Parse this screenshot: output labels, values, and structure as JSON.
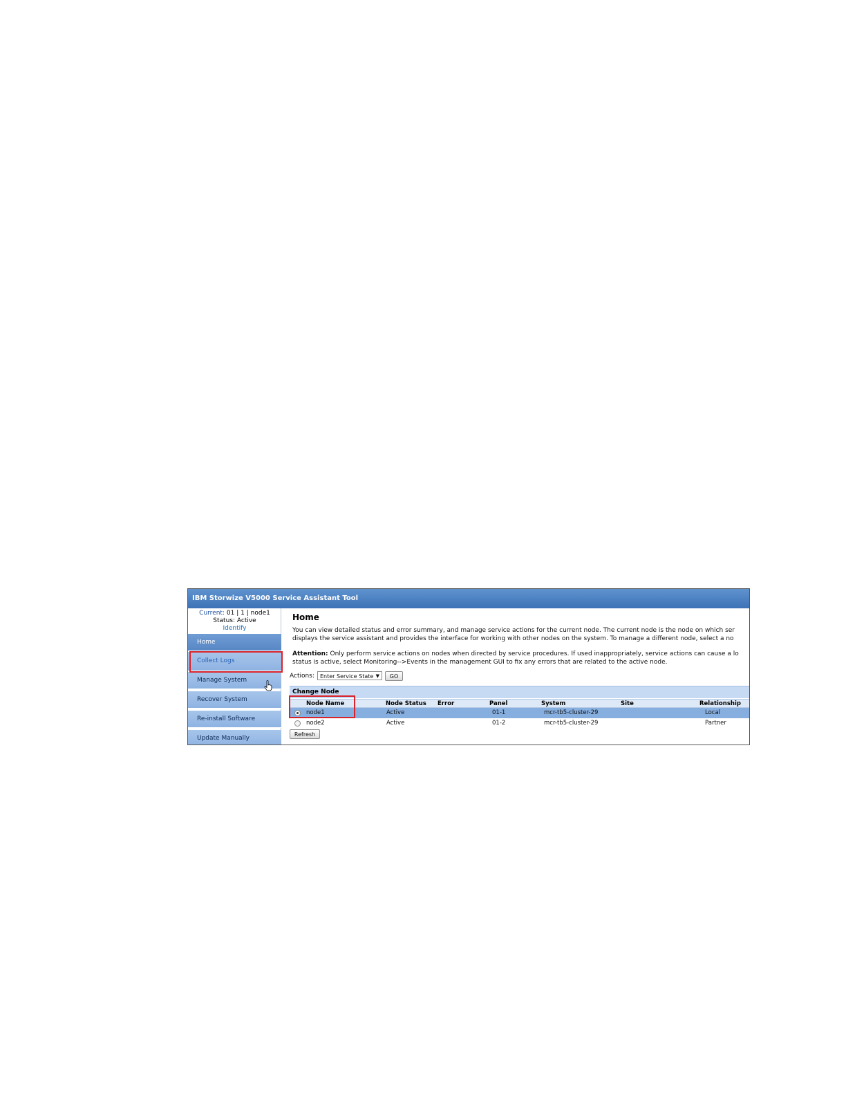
{
  "window": {
    "title": "IBM Storwize V5000 Service Assistant Tool"
  },
  "sidebar": {
    "current_label": "Current:",
    "current_values": [
      "01",
      "1",
      "node1"
    ],
    "separator": "|",
    "status_label": "Status:",
    "status_value": "Active",
    "identify_link": "Identify",
    "items": [
      {
        "label": "Home"
      },
      {
        "label": "Collect Logs"
      },
      {
        "label": "Manage System"
      },
      {
        "label": "Recover System"
      },
      {
        "label": "Re-install Software"
      },
      {
        "label": "Update Manually"
      }
    ]
  },
  "main": {
    "title": "Home",
    "description_1": "You can view detailed status and error summary, and manage service actions for the current node. The current node is the node on which ser",
    "description_2": "displays the service assistant and provides the interface for working with other nodes on the system. To manage a different node, select a no",
    "attention_label": "Attention:",
    "attention_1": "Only perform service actions on nodes when directed by service procedures. If used inappropriately, service actions can cause a lo",
    "attention_2": "status is active, select Monitoring-->Events in the management GUI to fix any errors that are related to the active node.",
    "actions_label": "Actions:",
    "actions_selected": "Enter Service State",
    "go_label": "GO",
    "change_node_title": "Change Node",
    "columns": [
      "Node Name",
      "Node Status",
      "Error",
      "Panel",
      "System",
      "Site",
      "Relationship"
    ],
    "rows": [
      {
        "name": "node1",
        "status": "Active",
        "error": "",
        "panel": "01-1",
        "system": "mcr-tb5-cluster-29",
        "site": "",
        "relationship": "Local",
        "selected": true
      },
      {
        "name": "node2",
        "status": "Active",
        "error": "",
        "panel": "01-2",
        "system": "mcr-tb5-cluster-29",
        "site": "",
        "relationship": "Partner",
        "selected": false
      }
    ],
    "refresh_label": "Refresh"
  },
  "icons": {
    "cursor": "hand-pointer-icon",
    "radio": "radio-button-icon",
    "dropdown": "triangle-down-icon"
  },
  "colors": {
    "titlebar": "#3d72b6",
    "nav": "#a7c5ea",
    "nav_active": "#5887c6",
    "selected_row": "#86aedf",
    "highlight_box": "#d9232a"
  }
}
